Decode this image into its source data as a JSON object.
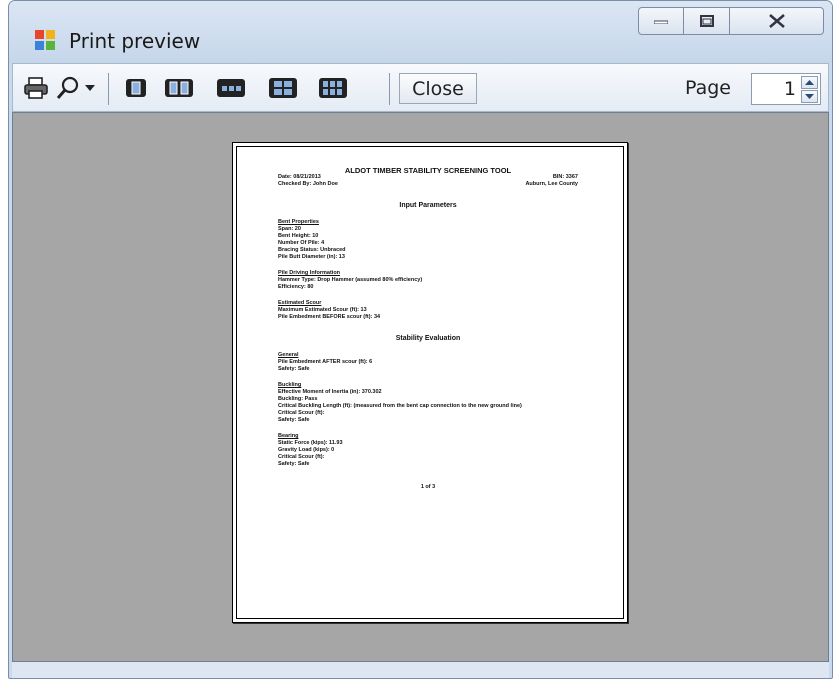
{
  "window": {
    "title": "Print preview"
  },
  "toolbar": {
    "close_label": "Close",
    "page_label": "Page",
    "page_value": "1",
    "icons": [
      "printer-icon",
      "zoom-icon",
      "chevron-down-icon",
      "one-page-icon",
      "two-pages-icon",
      "three-pages-icon",
      "four-pages-icon",
      "six-pages-icon"
    ]
  },
  "doc": {
    "title": "ALDOT TIMBER STABILITY SCREENING TOOL",
    "date": "Date: 08/21/2013",
    "bin": "BIN: 3367",
    "checked_by": "Checked By: John Doe",
    "location": "Auburn, Lee County",
    "input_heading": "Input Parameters",
    "bent_title": "Bent Properties",
    "bent_lines": [
      "Span: 20",
      "Bent Height: 10",
      "Number Of Pile: 4",
      "Bracing Status: Unbraced",
      "Pile Butt Diameter (in): 13"
    ],
    "pile_title": "Pile Driving Information",
    "pile_lines": [
      "Hammer Type: Drop Hammer (assumed 80% efficiency)",
      "Efficiency: 80"
    ],
    "scour_title": "Estimated Scour",
    "scour_lines": [
      "Maximum Estimated Scour (ft): 13",
      "Pile Embedment BEFORE scour (ft): 34"
    ],
    "stability_heading": "Stability Evaluation",
    "general_title": "General",
    "general_lines": [
      "Pile Embedment AFTER scour (ft): 6",
      "Safety: Safe"
    ],
    "buckling_title": "Buckling",
    "buckling_lines": [
      "Effective Moment of Inertia (in): 370.302",
      "Buckling: Pass",
      "Critical Buckling Length (ft): (measured from the bent cap connection to the new ground line)",
      "Critical Scour (ft):",
      "Safety: Safe"
    ],
    "bearing_title": "Bearing",
    "bearing_lines": [
      "Static Force (kips): 11.93",
      "Gravity Load (kips): 0",
      "Critical Scour (ft):",
      "Safety: Safe"
    ],
    "footer": "1 of 3"
  },
  "colors": {
    "preview_bg": "#a6a6a6",
    "window_frame": "#c9d9ee"
  }
}
